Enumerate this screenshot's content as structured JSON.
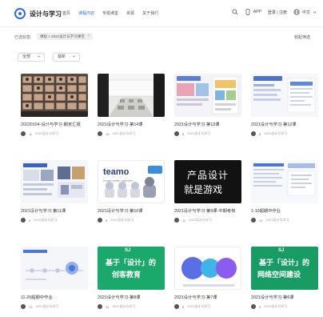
{
  "header": {
    "brand": "设计与学习",
    "nav": [
      "首页",
      "课程内容",
      "专题课堂",
      "资源",
      "关于我们"
    ],
    "nav_active_index": 1,
    "app_label": "APP",
    "login_label": "登录 | 注册",
    "lang_label": "中文"
  },
  "filter": {
    "label": "已选标签:",
    "tag": "课程 > 2021设计与学习课堂",
    "clear_label": "收起筛选"
  },
  "selectors": {
    "first": "全部",
    "second": "最新"
  },
  "cards": [
    {
      "title": "20220104-设计与学习-期末汇报",
      "count": "11",
      "sub": "2021设计与学习"
    },
    {
      "title": "2021设计与学习-第14课",
      "count": "16",
      "sub": "2021设计与学习"
    },
    {
      "title": "2021设计与学习-第13课",
      "count": "8",
      "sub": "2021设计与学习"
    },
    {
      "title": "2021设计与学习-第12课",
      "count": "8",
      "sub": "2021设计与学习"
    },
    {
      "title": "2021设计与学习-第11课",
      "count": "9",
      "sub": "2021设计与学习"
    },
    {
      "title": "2021设计与学习-第10课",
      "count": "8",
      "sub": "2021设计与学习"
    },
    {
      "title": "2021设计与学习-第9课-中期考核",
      "count": "11",
      "sub": "2021设计与学习"
    },
    {
      "title": "1-10超期中作业",
      "count": "12",
      "sub": "2021设计与学习"
    },
    {
      "title": "11-20超期中作业",
      "count": "13",
      "sub": "2021设计与学习"
    },
    {
      "title": "2021设计与学习-第8课",
      "count": "14",
      "sub": "2021设计与学习"
    },
    {
      "title": "2021设计与学习-第7课",
      "count": "8",
      "sub": "2021设计与学习"
    },
    {
      "title": "2021设计与学习-第6课",
      "count": "9",
      "sub": "2021设计与学习"
    }
  ],
  "thumb_text": {
    "teamo": "teamo",
    "teamo_sub": "Learn better together",
    "product_1": "产品设计",
    "product_2": "就是游戏",
    "green1_top": "SJ",
    "green1_1": "基于「设计」的",
    "green1_2": "创客教育",
    "green2_top": "SJ",
    "green2_1": "基于「设计」的",
    "green2_2": "网络空间建设"
  },
  "colors": {
    "accent": "#2f6fd8",
    "green": "#1aa86b",
    "dark": "#121212"
  }
}
